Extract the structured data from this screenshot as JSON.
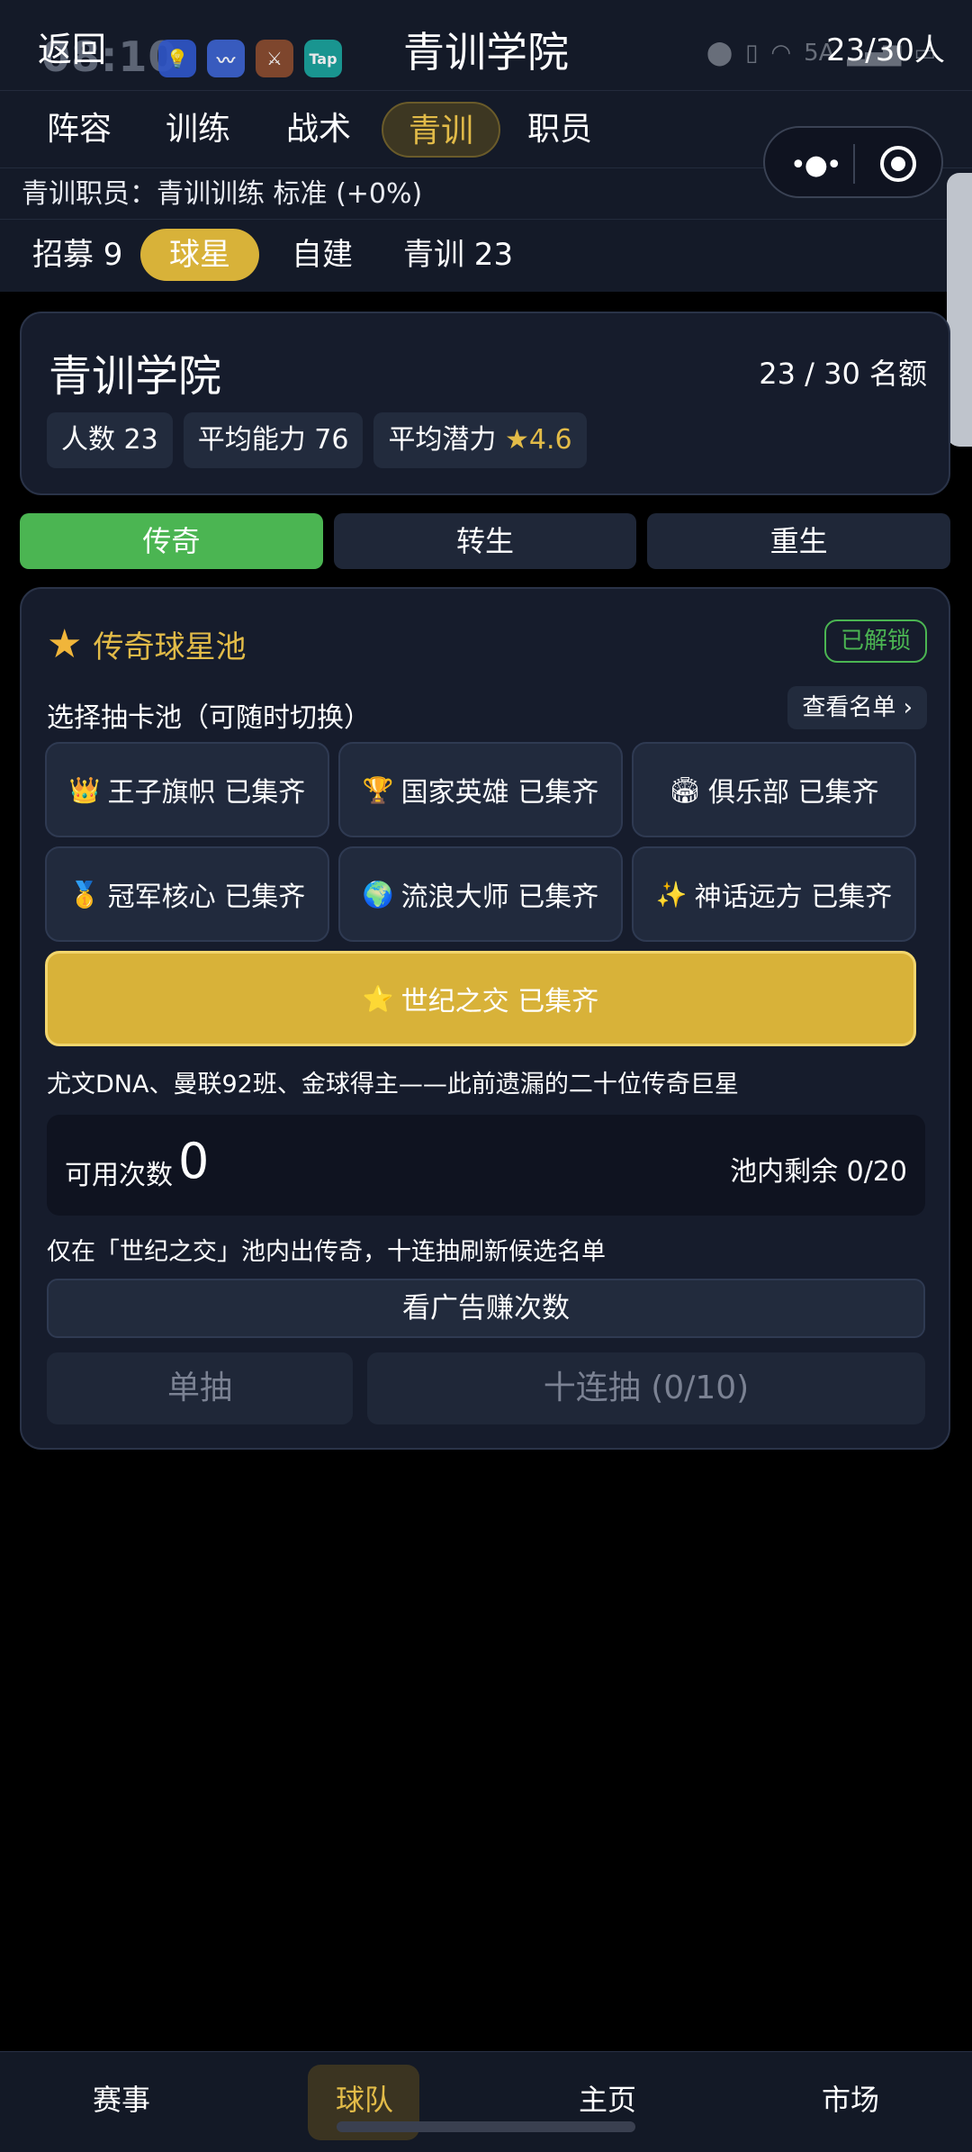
{
  "status": {
    "time": "08:10",
    "net": "5A"
  },
  "header": {
    "back": "返回",
    "title": "青训学院",
    "count": "23/30人"
  },
  "nav": [
    {
      "label": "阵容"
    },
    {
      "label": "训练"
    },
    {
      "label": "战术"
    },
    {
      "label": "青训",
      "active": true
    },
    {
      "label": "职员"
    }
  ],
  "staff_line": "青训职员：青训训练 标准 (+0%)",
  "subnav": [
    {
      "label": "招募 9"
    },
    {
      "label": "球星",
      "active": true
    },
    {
      "label": "自建"
    },
    {
      "label": "青训 23"
    }
  ],
  "summary": {
    "title": "青训学院",
    "quota": "23 / 30 名额",
    "chip_count": "人数 23",
    "chip_ability": "平均能力 76",
    "chip_potential_label": "平均潜力",
    "chip_potential_value": "★4.6"
  },
  "modes": [
    {
      "label": "传奇",
      "active": true
    },
    {
      "label": "转生"
    },
    {
      "label": "重生"
    }
  ],
  "pool": {
    "name": "传奇球星池",
    "status": "已解锁",
    "select_label": "选择抽卡池（可随时切换）",
    "view_list": "查看名单 ›",
    "options": [
      {
        "icon": "👑",
        "label": "王子旗帜 已集齐"
      },
      {
        "icon": "🏆",
        "label": "国家英雄 已集齐"
      },
      {
        "icon": "🏟",
        "label": "俱乐部 已集齐"
      },
      {
        "icon": "🥇",
        "label": "冠军核心 已集齐"
      },
      {
        "icon": "🌍",
        "label": "流浪大师 已集齐"
      },
      {
        "icon": "✨",
        "label": "神话远方 已集齐"
      },
      {
        "icon": "⭐",
        "label": "世纪之交 已集齐"
      }
    ],
    "description": "尤文DNA、曼联92班、金球得主——此前遗漏的二十位传奇巨星",
    "available_label": "可用次数",
    "available_value": "0",
    "remaining": "池内剩余 0/20",
    "note": "仅在「世纪之交」池内出传奇，十连抽刷新候选名单",
    "ad_button": "看广告赚次数",
    "single_draw": "单抽",
    "ten_draw": "十连抽 (0/10)"
  },
  "tabbar": [
    {
      "label": "赛事"
    },
    {
      "label": "球队",
      "active": true
    },
    {
      "label": "主页"
    },
    {
      "label": "市场"
    }
  ],
  "colors": {
    "accent_gold": "#d8b239",
    "active_green": "#4bb552",
    "card_bg": "#161c2c"
  }
}
